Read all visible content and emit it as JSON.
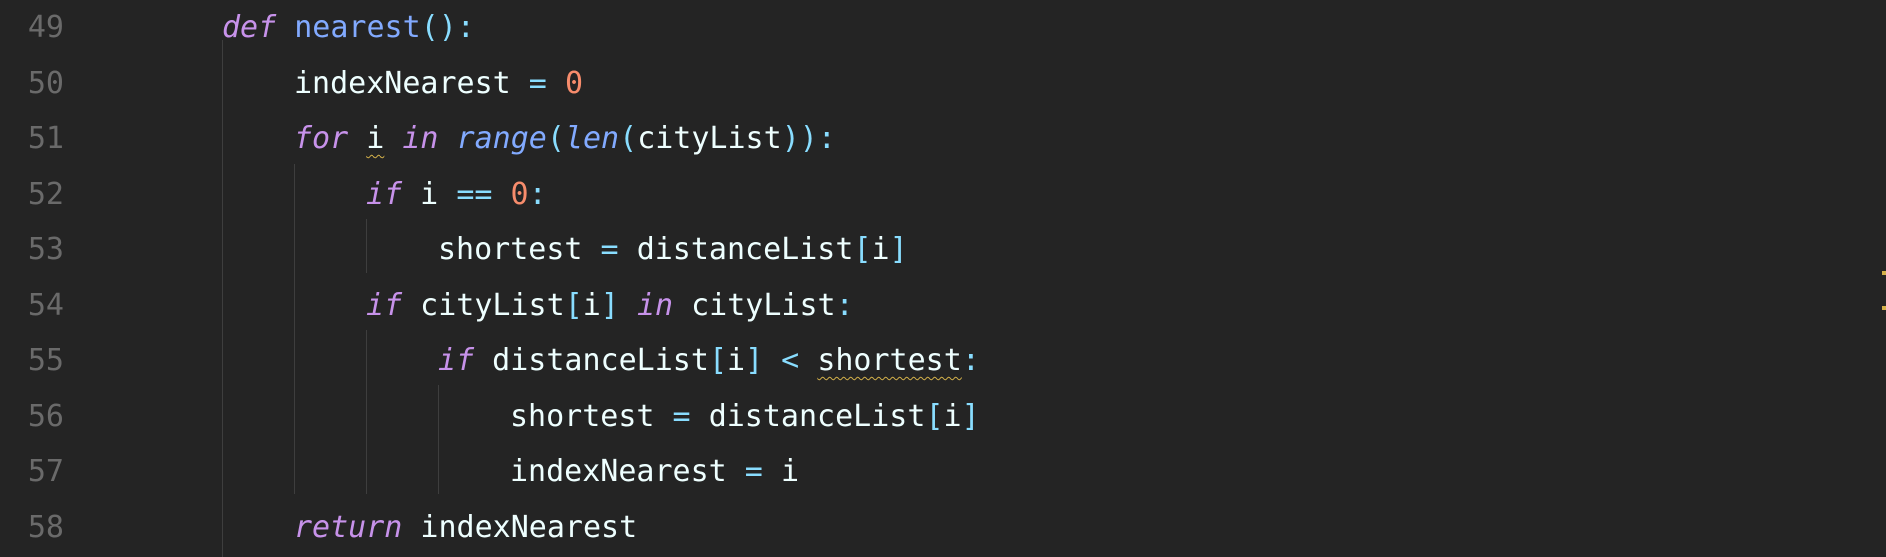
{
  "editor": {
    "warning_marker_color": "#d4b14a",
    "lines": [
      {
        "number": "49",
        "tokens": [
          {
            "t": "def",
            "c": "kw"
          },
          {
            "t": " ",
            "c": "id"
          },
          {
            "t": "nearest",
            "c": "fn"
          },
          {
            "t": "():",
            "c": "op"
          }
        ]
      },
      {
        "number": "50",
        "tokens": [
          {
            "t": "indexNearest",
            "c": "id"
          },
          {
            "t": " = ",
            "c": "op"
          },
          {
            "t": "0",
            "c": "num"
          }
        ]
      },
      {
        "number": "51",
        "tokens": [
          {
            "t": "for",
            "c": "kw"
          },
          {
            "t": " ",
            "c": "id"
          },
          {
            "t": "i",
            "c": "id squiggle"
          },
          {
            "t": " ",
            "c": "id"
          },
          {
            "t": "in",
            "c": "kw"
          },
          {
            "t": " ",
            "c": "id"
          },
          {
            "t": "range",
            "c": "bi"
          },
          {
            "t": "(",
            "c": "op"
          },
          {
            "t": "len",
            "c": "bi"
          },
          {
            "t": "(",
            "c": "op"
          },
          {
            "t": "cityList",
            "c": "id"
          },
          {
            "t": ")):",
            "c": "op"
          }
        ]
      },
      {
        "number": "52",
        "tokens": [
          {
            "t": "if",
            "c": "kw"
          },
          {
            "t": " i ",
            "c": "id"
          },
          {
            "t": "==",
            "c": "op"
          },
          {
            "t": " ",
            "c": "id"
          },
          {
            "t": "0",
            "c": "num"
          },
          {
            "t": ":",
            "c": "op"
          }
        ]
      },
      {
        "number": "53",
        "tokens": [
          {
            "t": "shortest",
            "c": "id"
          },
          {
            "t": " = ",
            "c": "op"
          },
          {
            "t": "distanceList",
            "c": "id"
          },
          {
            "t": "[",
            "c": "op"
          },
          {
            "t": "i",
            "c": "id"
          },
          {
            "t": "]",
            "c": "op"
          }
        ]
      },
      {
        "number": "54",
        "tokens": [
          {
            "t": "if",
            "c": "kw"
          },
          {
            "t": " cityList",
            "c": "id"
          },
          {
            "t": "[",
            "c": "op"
          },
          {
            "t": "i",
            "c": "id"
          },
          {
            "t": "]",
            "c": "op"
          },
          {
            "t": " ",
            "c": "id"
          },
          {
            "t": "in",
            "c": "kw"
          },
          {
            "t": " cityList",
            "c": "id"
          },
          {
            "t": ":",
            "c": "op"
          }
        ]
      },
      {
        "number": "55",
        "tokens": [
          {
            "t": "if",
            "c": "kw"
          },
          {
            "t": " distanceList",
            "c": "id"
          },
          {
            "t": "[",
            "c": "op"
          },
          {
            "t": "i",
            "c": "id"
          },
          {
            "t": "]",
            "c": "op"
          },
          {
            "t": " < ",
            "c": "op"
          },
          {
            "t": "shortest",
            "c": "id squiggle"
          },
          {
            "t": ":",
            "c": "op"
          }
        ]
      },
      {
        "number": "56",
        "tokens": [
          {
            "t": "shortest",
            "c": "id"
          },
          {
            "t": " = ",
            "c": "op"
          },
          {
            "t": "distanceList",
            "c": "id"
          },
          {
            "t": "[",
            "c": "op"
          },
          {
            "t": "i",
            "c": "id"
          },
          {
            "t": "]",
            "c": "op"
          }
        ]
      },
      {
        "number": "57",
        "tokens": [
          {
            "t": "indexNearest",
            "c": "id"
          },
          {
            "t": " = ",
            "c": "op"
          },
          {
            "t": "i",
            "c": "id"
          }
        ]
      },
      {
        "number": "58",
        "tokens": [
          {
            "t": "return",
            "c": "kw"
          },
          {
            "t": " indexNearest",
            "c": "id"
          }
        ]
      }
    ]
  }
}
